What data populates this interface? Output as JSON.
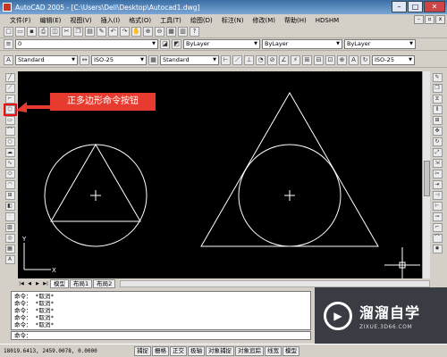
{
  "window": {
    "title": "AutoCAD 2005 - [C:\\Users\\Dell\\Desktop\\Autocad1.dwg]"
  },
  "menu": [
    "文件(F)",
    "编辑(E)",
    "视图(V)",
    "插入(I)",
    "格式(O)",
    "工具(T)",
    "绘图(D)",
    "标注(N)",
    "修改(M)",
    "帮助(H)",
    "HDSHM"
  ],
  "toolbar1": {
    "layer": "0",
    "color": "ByLayer",
    "linetype": "ByLayer",
    "lineweight": "ByLayer"
  },
  "toolbar2": {
    "text_style": "Standard",
    "dim_style": "ISO-25",
    "table_style": "Standard",
    "mleader_style": "ISO-25"
  },
  "annotation": {
    "label": "正多边形命令按钮",
    "color": "#e63b2e"
  },
  "tabs": [
    "模型",
    "布局1",
    "布局2"
  ],
  "command": {
    "log": [
      "命令：  *取消*",
      "命令：  *取消*",
      "命令：  *取消*",
      "命令：  *取消*",
      "命令：  *取消*"
    ],
    "prompt": "命令："
  },
  "status": {
    "coords": "18019.6413, 2459.0078, 0.0000",
    "buttons": [
      "捕捉",
      "栅格",
      "正交",
      "极轴",
      "对象捕捉",
      "对象追踪",
      "线宽",
      "模型"
    ]
  },
  "watermark": {
    "brand": "溜溜自学",
    "url": "ZIXUE.3D66.COM"
  },
  "colors": {
    "canvas": "#000000",
    "geometry": "#ffffff",
    "highlight": "#e11111"
  }
}
